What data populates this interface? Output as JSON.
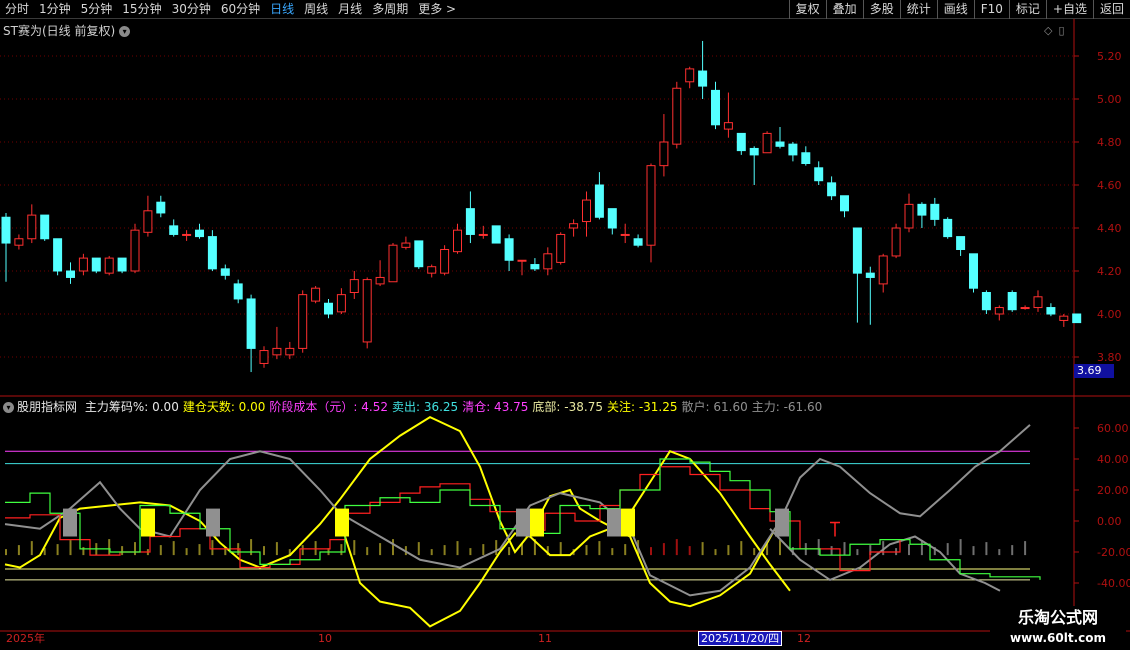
{
  "toolbar": {
    "periods": [
      "分时",
      "1分钟",
      "5分钟",
      "15分钟",
      "30分钟",
      "60分钟",
      "日线",
      "周线",
      "月线",
      "多周期",
      "更多 >"
    ],
    "active_period": "日线",
    "tools": [
      "复权",
      "叠加",
      "多股",
      "统计",
      "画线",
      "F10",
      "标记",
      "+自选",
      "返回"
    ]
  },
  "stock": {
    "title": "ST赛为(日线 前复权)"
  },
  "price_axis": {
    "ticks": [
      "5.20",
      "5.00",
      "4.80",
      "4.60",
      "4.40",
      "4.20",
      "4.00",
      "3.80"
    ],
    "current_price": "3.69"
  },
  "indicator": {
    "name": "股朋指标网",
    "items": [
      {
        "label": "主力筹码%: 0.00",
        "color": "#e8e8e8"
      },
      {
        "label": "建仓天数: 0.00",
        "color": "#ffff00"
      },
      {
        "label": "阶段成本（元）: 4.52",
        "color": "#ff40ff"
      },
      {
        "label": "卖出: 36.25",
        "color": "#40e0e0"
      },
      {
        "label": "清仓: 43.75",
        "color": "#ff40ff"
      },
      {
        "label": "底部: -38.75",
        "color": "#e8e8a0"
      },
      {
        "label": "关注: -31.25",
        "color": "#ffff00"
      },
      {
        "label": "散户: 61.60",
        "color": "#909090"
      },
      {
        "label": "主力: -61.60",
        "color": "#909090"
      }
    ],
    "axis_ticks": [
      "60.00",
      "40.00",
      "20.00",
      "0.00",
      "-20.00",
      "-40.00"
    ]
  },
  "date_axis": {
    "labels": [
      "2025年",
      "10",
      "11",
      "2025/11/20/四",
      "12"
    ]
  },
  "colors": {
    "up": "#ff3030",
    "down": "#54ffff",
    "axis_red": "#b01010"
  },
  "watermark": {
    "line1": "乐淘公式网",
    "line2": "www.60lt.com"
  },
  "chart_data": {
    "type": "candlestick",
    "ylim": [
      3.7,
      5.3
    ],
    "candles": [
      {
        "o": 4.45,
        "h": 4.47,
        "l": 4.15,
        "c": 4.33
      },
      {
        "o": 4.32,
        "h": 4.37,
        "l": 4.3,
        "c": 4.35
      },
      {
        "o": 4.35,
        "h": 4.51,
        "l": 4.33,
        "c": 4.46
      },
      {
        "o": 4.46,
        "h": 4.46,
        "l": 4.34,
        "c": 4.35
      },
      {
        "o": 4.35,
        "h": 4.35,
        "l": 4.18,
        "c": 4.2
      },
      {
        "o": 4.2,
        "h": 4.24,
        "l": 4.14,
        "c": 4.17
      },
      {
        "o": 4.2,
        "h": 4.28,
        "l": 4.18,
        "c": 4.26
      },
      {
        "o": 4.26,
        "h": 4.26,
        "l": 4.19,
        "c": 4.2
      },
      {
        "o": 4.19,
        "h": 4.27,
        "l": 4.18,
        "c": 4.26
      },
      {
        "o": 4.26,
        "h": 4.26,
        "l": 4.19,
        "c": 4.2
      },
      {
        "o": 4.2,
        "h": 4.42,
        "l": 4.19,
        "c": 4.39
      },
      {
        "o": 4.38,
        "h": 4.55,
        "l": 4.36,
        "c": 4.48
      },
      {
        "o": 4.52,
        "h": 4.55,
        "l": 4.45,
        "c": 4.47
      },
      {
        "o": 4.41,
        "h": 4.44,
        "l": 4.36,
        "c": 4.37
      },
      {
        "o": 4.37,
        "h": 4.39,
        "l": 4.34,
        "c": 4.37
      },
      {
        "o": 4.39,
        "h": 4.42,
        "l": 4.35,
        "c": 4.36
      },
      {
        "o": 4.36,
        "h": 4.39,
        "l": 4.2,
        "c": 4.21
      },
      {
        "o": 4.21,
        "h": 4.23,
        "l": 4.16,
        "c": 4.18
      },
      {
        "o": 4.14,
        "h": 4.16,
        "l": 4.05,
        "c": 4.07
      },
      {
        "o": 4.07,
        "h": 4.09,
        "l": 3.73,
        "c": 3.84
      },
      {
        "o": 3.77,
        "h": 3.85,
        "l": 3.75,
        "c": 3.83
      },
      {
        "o": 3.81,
        "h": 3.94,
        "l": 3.79,
        "c": 3.84
      },
      {
        "o": 3.81,
        "h": 3.87,
        "l": 3.79,
        "c": 3.84
      },
      {
        "o": 3.84,
        "h": 4.11,
        "l": 3.82,
        "c": 4.09
      },
      {
        "o": 4.06,
        "h": 4.13,
        "l": 4.05,
        "c": 4.12
      },
      {
        "o": 4.05,
        "h": 4.07,
        "l": 3.98,
        "c": 4.0
      },
      {
        "o": 4.01,
        "h": 4.12,
        "l": 4.0,
        "c": 4.09
      },
      {
        "o": 4.1,
        "h": 4.2,
        "l": 4.07,
        "c": 4.16
      },
      {
        "o": 3.87,
        "h": 4.17,
        "l": 3.84,
        "c": 4.16
      },
      {
        "o": 4.14,
        "h": 4.25,
        "l": 4.13,
        "c": 4.17
      },
      {
        "o": 4.15,
        "h": 4.33,
        "l": 4.15,
        "c": 4.32
      },
      {
        "o": 4.31,
        "h": 4.36,
        "l": 4.3,
        "c": 4.33
      },
      {
        "o": 4.34,
        "h": 4.34,
        "l": 4.21,
        "c": 4.22
      },
      {
        "o": 4.19,
        "h": 4.23,
        "l": 4.17,
        "c": 4.22
      },
      {
        "o": 4.19,
        "h": 4.32,
        "l": 4.18,
        "c": 4.3
      },
      {
        "o": 4.29,
        "h": 4.42,
        "l": 4.28,
        "c": 4.39
      },
      {
        "o": 4.49,
        "h": 4.57,
        "l": 4.33,
        "c": 4.37
      },
      {
        "o": 4.37,
        "h": 4.41,
        "l": 4.35,
        "c": 4.37
      },
      {
        "o": 4.41,
        "h": 4.41,
        "l": 4.33,
        "c": 4.33
      },
      {
        "o": 4.35,
        "h": 4.37,
        "l": 4.2,
        "c": 4.25
      },
      {
        "o": 4.25,
        "h": 4.25,
        "l": 4.18,
        "c": 4.25
      },
      {
        "o": 4.23,
        "h": 4.26,
        "l": 4.2,
        "c": 4.21
      },
      {
        "o": 4.21,
        "h": 4.31,
        "l": 4.18,
        "c": 4.28
      },
      {
        "o": 4.24,
        "h": 4.38,
        "l": 4.23,
        "c": 4.37
      },
      {
        "o": 4.4,
        "h": 4.44,
        "l": 4.36,
        "c": 4.42
      },
      {
        "o": 4.43,
        "h": 4.57,
        "l": 4.36,
        "c": 4.53
      },
      {
        "o": 4.6,
        "h": 4.66,
        "l": 4.44,
        "c": 4.45
      },
      {
        "o": 4.49,
        "h": 4.49,
        "l": 4.37,
        "c": 4.4
      },
      {
        "o": 4.37,
        "h": 4.42,
        "l": 4.33,
        "c": 4.37
      },
      {
        "o": 4.35,
        "h": 4.37,
        "l": 4.31,
        "c": 4.32
      },
      {
        "o": 4.32,
        "h": 4.7,
        "l": 4.24,
        "c": 4.69
      },
      {
        "o": 4.69,
        "h": 4.93,
        "l": 4.64,
        "c": 4.8
      },
      {
        "o": 4.79,
        "h": 5.08,
        "l": 4.77,
        "c": 5.05
      },
      {
        "o": 5.08,
        "h": 5.15,
        "l": 5.05,
        "c": 5.14
      },
      {
        "o": 5.13,
        "h": 5.27,
        "l": 5.0,
        "c": 5.06
      },
      {
        "o": 5.04,
        "h": 5.08,
        "l": 4.86,
        "c": 4.88
      },
      {
        "o": 4.86,
        "h": 5.03,
        "l": 4.82,
        "c": 4.89
      },
      {
        "o": 4.84,
        "h": 4.84,
        "l": 4.74,
        "c": 4.76
      },
      {
        "o": 4.77,
        "h": 4.78,
        "l": 4.6,
        "c": 4.74
      },
      {
        "o": 4.75,
        "h": 4.85,
        "l": 4.75,
        "c": 4.84
      },
      {
        "o": 4.8,
        "h": 4.87,
        "l": 4.77,
        "c": 4.78
      },
      {
        "o": 4.79,
        "h": 4.8,
        "l": 4.71,
        "c": 4.74
      },
      {
        "o": 4.75,
        "h": 4.78,
        "l": 4.69,
        "c": 4.7
      },
      {
        "o": 4.68,
        "h": 4.71,
        "l": 4.6,
        "c": 4.62
      },
      {
        "o": 4.61,
        "h": 4.64,
        "l": 4.53,
        "c": 4.55
      },
      {
        "o": 4.55,
        "h": 4.55,
        "l": 4.45,
        "c": 4.48
      },
      {
        "o": 4.4,
        "h": 4.4,
        "l": 3.96,
        "c": 4.19
      },
      {
        "o": 4.19,
        "h": 4.22,
        "l": 3.95,
        "c": 4.17
      },
      {
        "o": 4.14,
        "h": 4.28,
        "l": 4.1,
        "c": 4.27
      },
      {
        "o": 4.27,
        "h": 4.42,
        "l": 4.26,
        "c": 4.4
      },
      {
        "o": 4.4,
        "h": 4.56,
        "l": 4.38,
        "c": 4.51
      },
      {
        "o": 4.51,
        "h": 4.52,
        "l": 4.4,
        "c": 4.46
      },
      {
        "o": 4.51,
        "h": 4.54,
        "l": 4.41,
        "c": 4.44
      },
      {
        "o": 4.44,
        "h": 4.45,
        "l": 4.35,
        "c": 4.36
      },
      {
        "o": 4.36,
        "h": 4.36,
        "l": 4.27,
        "c": 4.3
      },
      {
        "o": 4.28,
        "h": 4.28,
        "l": 4.1,
        "c": 4.12
      },
      {
        "o": 4.1,
        "h": 4.11,
        "l": 4.0,
        "c": 4.02
      },
      {
        "o": 4.0,
        "h": 4.04,
        "l": 3.97,
        "c": 4.03
      },
      {
        "o": 4.1,
        "h": 4.11,
        "l": 4.01,
        "c": 4.02
      },
      {
        "o": 4.03,
        "h": 4.04,
        "l": 4.02,
        "c": 4.03
      },
      {
        "o": 4.03,
        "h": 4.11,
        "l": 4.01,
        "c": 4.08
      },
      {
        "o": 4.03,
        "h": 4.05,
        "l": 3.99,
        "c": 4.0
      },
      {
        "o": 3.97,
        "h": 4.0,
        "l": 3.94,
        "c": 3.99
      },
      {
        "o": 4.0,
        "h": 4.0,
        "l": 3.96,
        "c": 3.96
      }
    ]
  }
}
